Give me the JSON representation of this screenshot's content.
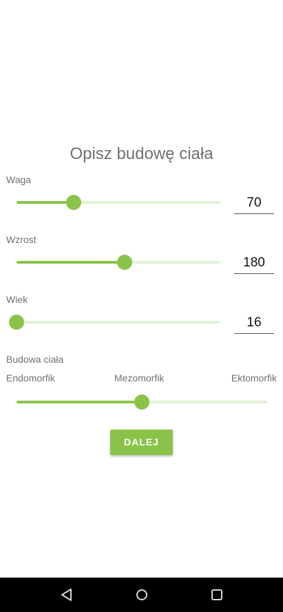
{
  "title": "Opisz budowę ciała",
  "fields": [
    {
      "label": "Waga",
      "value": "70",
      "level": 0.28
    },
    {
      "label": "Wzrost",
      "value": "180",
      "level": 0.53
    },
    {
      "label": "Wiek",
      "value": "16",
      "level": 0.0
    }
  ],
  "body_type": {
    "label": "Budowa ciała",
    "options": [
      "Endomorfik",
      "Mezomorfik",
      "Ektomorfik"
    ],
    "level": 0.5
  },
  "next_button": "DALEJ",
  "colors": {
    "accent": "#8bc34a",
    "track": "#e3f2d6"
  },
  "navbar": {
    "icons": [
      "back-icon",
      "home-icon",
      "recents-icon"
    ]
  }
}
